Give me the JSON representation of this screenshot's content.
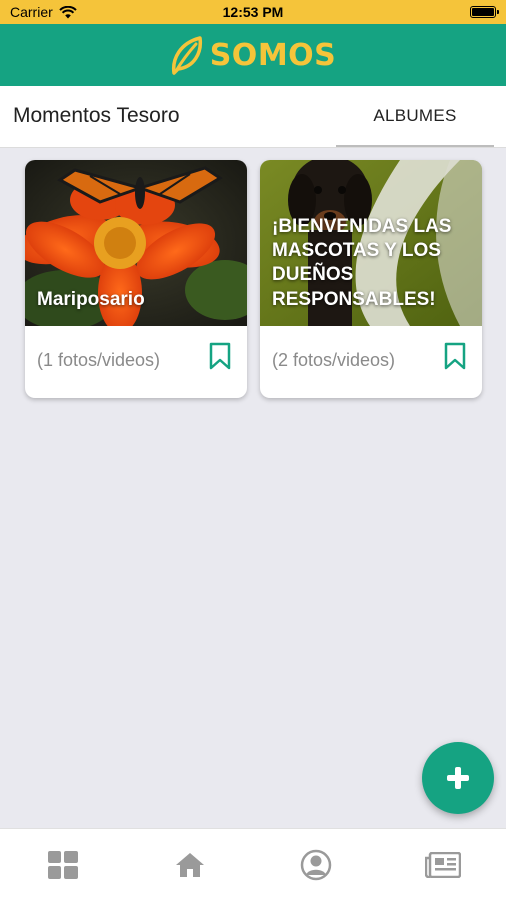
{
  "status_bar": {
    "carrier": "Carrier",
    "time": "12:53 PM"
  },
  "app_bar": {
    "brand": "SOMOS",
    "brand_color": "#f5c43a",
    "bar_color": "#15a382"
  },
  "tabs": {
    "title": "Momentos Tesoro",
    "albums_label": "ALBUMES"
  },
  "albums": [
    {
      "title": "Mariposario",
      "count": "(1 fotos/videos)"
    },
    {
      "title": "¡BIENVENIDAS LAS MASCOTAS Y LOS DUEÑOS RESPONSABLES!",
      "count": "(2 fotos/videos)"
    }
  ],
  "fab": {
    "icon": "plus-icon"
  },
  "bottom_nav": {
    "items": [
      "grid-icon",
      "home-icon",
      "profile-icon",
      "news-icon"
    ]
  }
}
